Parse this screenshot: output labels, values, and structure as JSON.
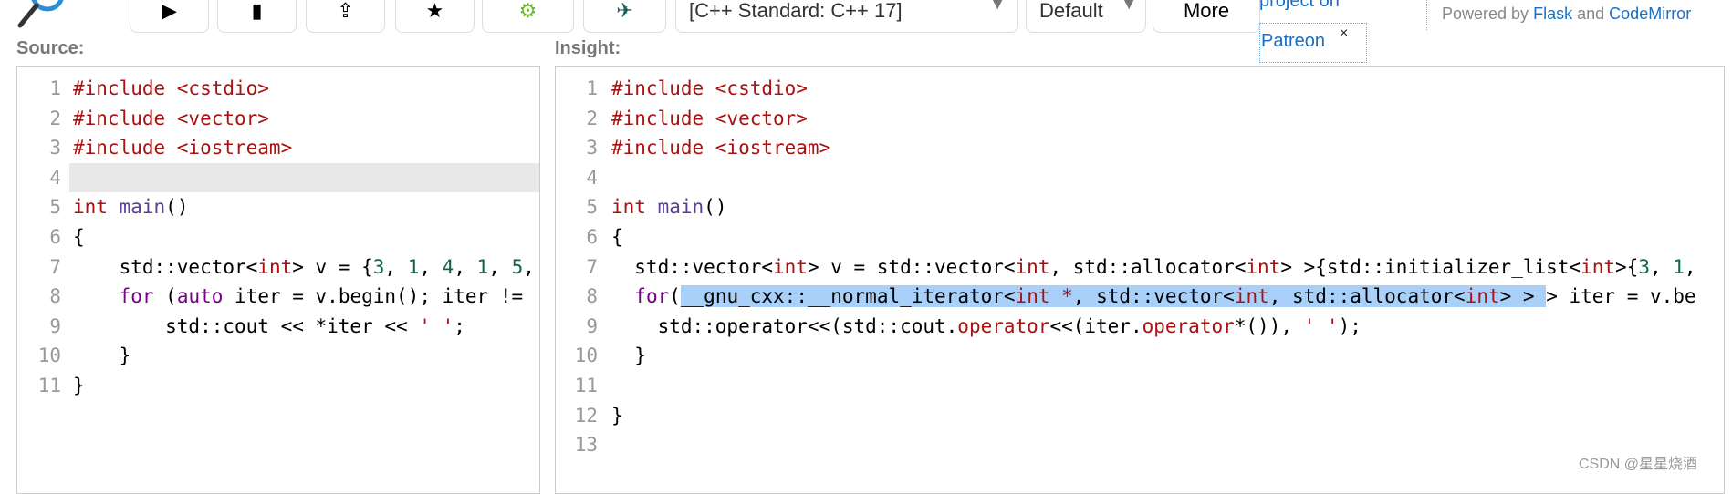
{
  "toolbar": {
    "logo_icon": "magnifier-logo-icon",
    "buttons": [
      {
        "icon": "play-icon",
        "glyph": "▶"
      },
      {
        "icon": "file-icon",
        "glyph": "▮"
      },
      {
        "icon": "upload-icon",
        "glyph": "⇪"
      },
      {
        "icon": "star-icon",
        "glyph": "★"
      },
      {
        "icon": "gear-icon",
        "glyph": "⚙"
      },
      {
        "icon": "bird-icon",
        "glyph": "✈"
      }
    ],
    "standard_select": "[C++ Standard: C++ 17]",
    "theme_select": "Default",
    "more_label": "More",
    "patreon_top": "project on",
    "patreon_link": "Patreon",
    "patreon_close": "×",
    "powered_by": "Powered by",
    "flask": "Flask",
    "and": "and",
    "codemirror": "CodeMirror"
  },
  "colors": {
    "link": "#1a6fc4",
    "highlight": "#a8d0f8",
    "active_line": "#e8e8e8"
  },
  "source": {
    "label": "Source:",
    "active_line": 4,
    "lines": [
      [
        [
          "#include <cstdio>",
          "meta"
        ]
      ],
      [
        [
          "#include <vector>",
          "meta"
        ]
      ],
      [
        [
          "#include <iostream>",
          "meta"
        ]
      ],
      [],
      [
        [
          "int",
          "type"
        ],
        [
          " ",
          "var"
        ],
        [
          "main",
          "def"
        ],
        [
          "()",
          "var"
        ]
      ],
      [
        [
          "{",
          "var"
        ]
      ],
      [
        [
          "    std::vector<",
          "var"
        ],
        [
          "int",
          "type"
        ],
        [
          "> v = {",
          "var"
        ],
        [
          "3",
          "num"
        ],
        [
          ", ",
          "var"
        ],
        [
          "1",
          "num"
        ],
        [
          ", ",
          "var"
        ],
        [
          "4",
          "num"
        ],
        [
          ", ",
          "var"
        ],
        [
          "1",
          "num"
        ],
        [
          ", ",
          "var"
        ],
        [
          "5",
          "num"
        ],
        [
          ",",
          "var"
        ]
      ],
      [
        [
          "    ",
          "var"
        ],
        [
          "for",
          "kw"
        ],
        [
          " (",
          "var"
        ],
        [
          "auto",
          "kw"
        ],
        [
          " iter = v.begin(); iter != ",
          "var"
        ]
      ],
      [
        [
          "        std::cout << *iter << ",
          "var"
        ],
        [
          "' '",
          "str"
        ],
        [
          ";",
          "var"
        ]
      ],
      [
        [
          "    }",
          "var"
        ]
      ],
      [
        [
          "}",
          "var"
        ]
      ]
    ]
  },
  "insight": {
    "label": "Insight:",
    "lines": [
      [
        [
          "#include <cstdio>",
          "meta"
        ]
      ],
      [
        [
          "#include <vector>",
          "meta"
        ]
      ],
      [
        [
          "#include <iostream>",
          "meta"
        ]
      ],
      [],
      [
        [
          "int",
          "type"
        ],
        [
          " ",
          "var"
        ],
        [
          "main",
          "def"
        ],
        [
          "()",
          "var"
        ]
      ],
      [
        [
          "{",
          "var"
        ]
      ],
      [
        [
          "  std::vector<",
          "var"
        ],
        [
          "int",
          "type"
        ],
        [
          "> v = std::vector<",
          "var"
        ],
        [
          "int",
          "type"
        ],
        [
          ", std::allocator<",
          "var"
        ],
        [
          "int",
          "type"
        ],
        [
          "> >{std::initializer_list<",
          "var"
        ],
        [
          "int",
          "type"
        ],
        [
          ">{",
          "var"
        ],
        [
          "3",
          "num"
        ],
        [
          ", ",
          "var"
        ],
        [
          "1",
          "num"
        ],
        [
          ",",
          "var"
        ]
      ],
      [
        [
          "  ",
          "var"
        ],
        [
          "for",
          "kw"
        ],
        [
          "(",
          "var"
        ],
        [
          "__gnu_cxx::__normal_iterator<",
          "var",
          "hl"
        ],
        [
          "int",
          "type",
          "hl"
        ],
        [
          " *",
          "type",
          "hl"
        ],
        [
          ", std::vector<",
          "var",
          "hl"
        ],
        [
          "int",
          "type",
          "hl"
        ],
        [
          ", std::allocator<",
          "var",
          "hl"
        ],
        [
          "int",
          "type",
          "hl"
        ],
        [
          "> > ",
          "var",
          "hl"
        ],
        [
          "> iter = v.be",
          "var"
        ]
      ],
      [
        [
          "    std::operator<<(std::cout.",
          "var"
        ],
        [
          "operator",
          "type"
        ],
        [
          "<<(iter.",
          "var"
        ],
        [
          "operator",
          "type"
        ],
        [
          "*()), ",
          "var"
        ],
        [
          "' '",
          "str"
        ],
        [
          ");",
          "var"
        ]
      ],
      [
        [
          "  }",
          "var"
        ]
      ],
      [],
      [
        [
          "}",
          "var"
        ]
      ],
      []
    ]
  },
  "watermark": "CSDN @星星烧酒"
}
